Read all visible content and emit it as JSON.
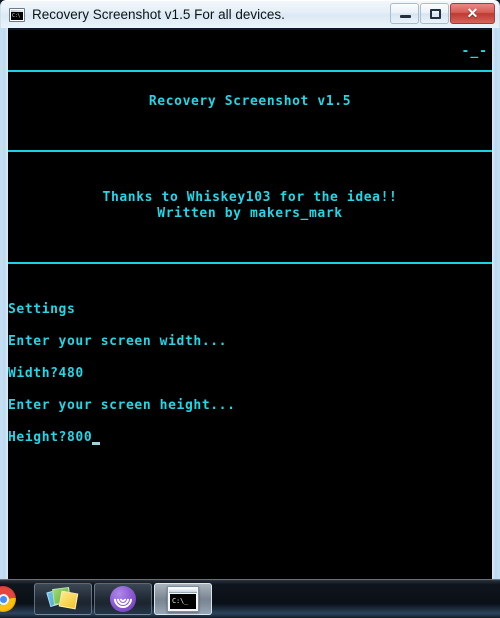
{
  "window": {
    "title": "Recovery Screenshot v1.5 For all devices.",
    "icon": "cmd-console-icon",
    "controls": {
      "minimize": "Minimize",
      "restore": "Restore Down",
      "close": "Close",
      "close_glyph": "✕"
    }
  },
  "console": {
    "foreground_color": "#21d7e8",
    "background_color": "#000000",
    "corner_marks": "-_-",
    "banner_title": "Recovery Screenshot v1.5",
    "credit_line_1": "Thanks to Whiskey103 for the idea!!",
    "credit_line_2": "Written by makers_mark",
    "settings_heading": "Settings",
    "prompt_width_text": "Enter your screen width...",
    "prompt_width_answer": "Width?480",
    "prompt_height_text": "Enter your screen height...",
    "prompt_height_answer": "Height?800",
    "width_value": "480",
    "height_value": "800"
  },
  "taskbar": {
    "items": [
      {
        "name": "chrome",
        "label": "Google Chrome",
        "state": "partial"
      },
      {
        "name": "sticky-notes",
        "label": "Sticky Notes",
        "state": "pinned"
      },
      {
        "name": "bittorrent",
        "label": "BitTorrent",
        "state": "pinned"
      },
      {
        "name": "command-prompt",
        "label": "Recovery Screenshot v1.5",
        "state": "active",
        "icon_text": "C:\\_"
      }
    ]
  }
}
